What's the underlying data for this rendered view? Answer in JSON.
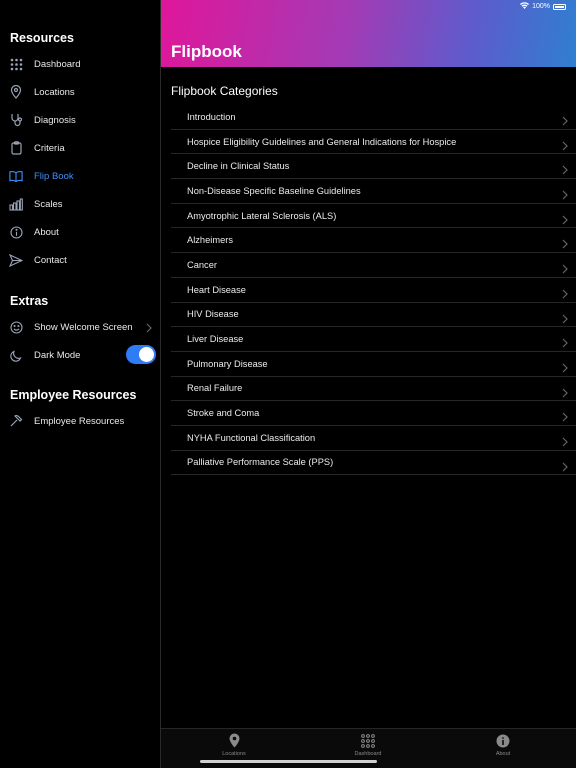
{
  "colors": {
    "accent": "#3f8ef7",
    "toggle_on": "#2f7cf6",
    "header_gradient": [
      "#e0169a",
      "#2f7fd0"
    ]
  },
  "status_bar": {
    "battery": "100%"
  },
  "sidebar": {
    "resources_title": "Resources",
    "resources": [
      {
        "label": "Dashboard",
        "icon": "grid-icon"
      },
      {
        "label": "Locations",
        "icon": "location-pin-icon"
      },
      {
        "label": "Diagnosis",
        "icon": "stethoscope-icon"
      },
      {
        "label": "Criteria",
        "icon": "clipboard-icon"
      },
      {
        "label": "Flip Book",
        "icon": "book-icon",
        "active": true
      },
      {
        "label": "Scales",
        "icon": "bar-chart-icon"
      },
      {
        "label": "About",
        "icon": "info-icon"
      },
      {
        "label": "Contact",
        "icon": "paper-plane-icon"
      }
    ],
    "extras_title": "Extras",
    "extras": [
      {
        "label": "Show Welcome Screen",
        "icon": "smiley-icon"
      },
      {
        "label": "Dark Mode",
        "icon": "moon-icon",
        "toggle": true
      }
    ],
    "employee_title": "Employee Resources",
    "employee": [
      {
        "label": "Employee Resources",
        "icon": "hammer-icon"
      }
    ]
  },
  "header": {
    "title": "Flipbook"
  },
  "main": {
    "section_title": "Flipbook Categories",
    "categories": [
      "Introduction",
      "Hospice Eligibility Guidelines and General Indications for Hospice",
      "Decline in Clinical Status",
      "Non-Disease Specific Baseline Guidelines",
      "Amyotrophic Lateral Sclerosis (ALS)",
      "Alzheimers",
      "Cancer",
      "Heart Disease",
      "HIV Disease",
      "Liver Disease",
      "Pulmonary Disease",
      "Renal Failure",
      "Stroke and Coma",
      "NYHA Functional Classification",
      "Palliative Performance Scale (PPS)"
    ]
  },
  "tabbar": {
    "tabs": [
      {
        "label": "Locations",
        "icon": "location-pin-icon"
      },
      {
        "label": "Dashboard",
        "icon": "grid-icon"
      },
      {
        "label": "About",
        "icon": "info-icon"
      }
    ]
  }
}
